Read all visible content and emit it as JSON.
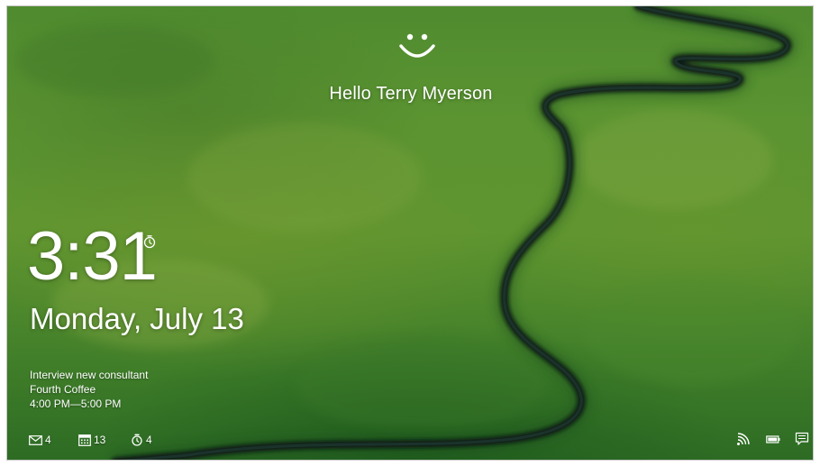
{
  "lock_screen": {
    "greeting": "Hello Terry Myerson",
    "time": "3:31",
    "date": "Monday, July 13",
    "appointment": {
      "title": "Interview new consultant",
      "location": "Fourth Coffee",
      "time_range": "4:00 PM—5:00 PM"
    },
    "notification_badges": [
      {
        "icon": "mail-icon",
        "count": "4"
      },
      {
        "icon": "calendar-icon",
        "count": "13"
      },
      {
        "icon": "alarm-icon",
        "count": "4"
      }
    ],
    "status_icons": [
      "wifi-icon",
      "battery-icon",
      "notification-center-icon"
    ],
    "icons": {
      "face_recognition": "smiley-face-icon",
      "clock_alarm_indicator": "alarm-clock-icon"
    },
    "colors": {
      "text": "#ffffff",
      "grass": "#5b9431",
      "river": "#0f1a16"
    }
  }
}
